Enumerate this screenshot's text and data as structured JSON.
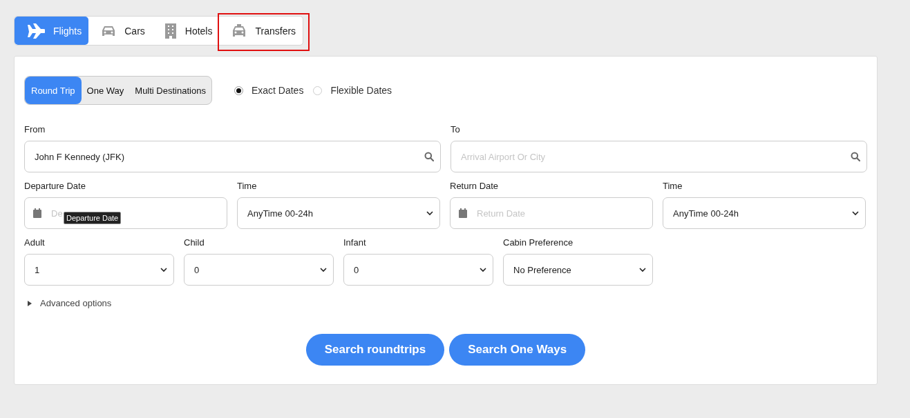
{
  "service_tabs": [
    {
      "label": "Flights",
      "kind": "plane",
      "selected": true,
      "highlighted": false
    },
    {
      "label": "Cars",
      "kind": "car",
      "selected": false,
      "highlighted": false
    },
    {
      "label": "Hotels",
      "kind": "building",
      "selected": false,
      "highlighted": false
    },
    {
      "label": "Transfers",
      "kind": "taxi",
      "selected": false,
      "highlighted": true
    }
  ],
  "trip_types": [
    {
      "label": "Round Trip",
      "selected": true
    },
    {
      "label": "One Way",
      "selected": false
    },
    {
      "label": "Multi Destinations",
      "selected": false
    }
  ],
  "date_modes": [
    {
      "label": "Exact Dates",
      "selected": true
    },
    {
      "label": "Flexible Dates",
      "selected": false
    }
  ],
  "route": [
    {
      "label": "From",
      "kind": "search",
      "value": "John F Kennedy (JFK)"
    },
    {
      "label": "To",
      "kind": "search",
      "placeholder": "Arrival Airport Or City"
    }
  ],
  "dates": [
    {
      "label": "Departure Date",
      "kind": "date",
      "placeholder": "De",
      "tooltip": "Departure Date"
    },
    {
      "label": "Time",
      "kind": "select",
      "value": "AnyTime 00-24h"
    },
    {
      "label": "Return Date",
      "kind": "date",
      "placeholder": "Return Date"
    },
    {
      "label": "Time",
      "kind": "select",
      "value": "AnyTime 00-24h"
    }
  ],
  "passengers": [
    {
      "label": "Adult",
      "kind": "select",
      "value": "1"
    },
    {
      "label": "Child",
      "kind": "select",
      "value": "0"
    },
    {
      "label": "Infant",
      "kind": "select",
      "value": "0"
    },
    {
      "label": "Cabin Preference",
      "kind": "select",
      "value": "No Preference"
    }
  ],
  "advanced_options": {
    "label": "Advanced options",
    "expanded": false
  },
  "buttons": [
    "Search roundtrips",
    "Search One Ways"
  ]
}
